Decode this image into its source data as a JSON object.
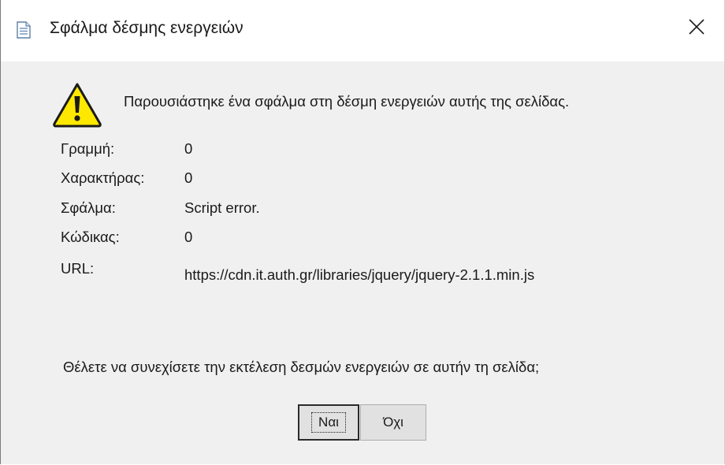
{
  "window": {
    "title": "Σφάλμα δέσμης ενεργειών",
    "title_icon": "document-icon",
    "close_icon": "close-icon",
    "close_symbol": "✕"
  },
  "message": {
    "icon": "warning-icon",
    "text": "Παρουσιάστηκε ένα σφάλμα στη δέσμη ενεργειών αυτής της σελίδας."
  },
  "details": [
    {
      "label": "Γραμμή:",
      "value": "0"
    },
    {
      "label": "Χαρακτήρας:",
      "value": "0"
    },
    {
      "label": "Σφάλμα:",
      "value": "Script error."
    },
    {
      "label": "Κώδικας:",
      "value": "0"
    },
    {
      "label": "URL:",
      "value": "https://cdn.it.auth.gr/libraries/jquery/jquery-2.1.1.min.js"
    }
  ],
  "question": "Θέλετε να συνεχίσετε την εκτέλεση δεσμών ενεργειών σε αυτήν τη σελίδα;",
  "buttons": {
    "yes_label": "Ναι",
    "no_label": "Όχι"
  },
  "colors": {
    "dialog_background": "#f0f0f0",
    "titlebar_background": "#ffffff",
    "warning_fill": "#ffe800",
    "text": "#1a1a1a"
  }
}
